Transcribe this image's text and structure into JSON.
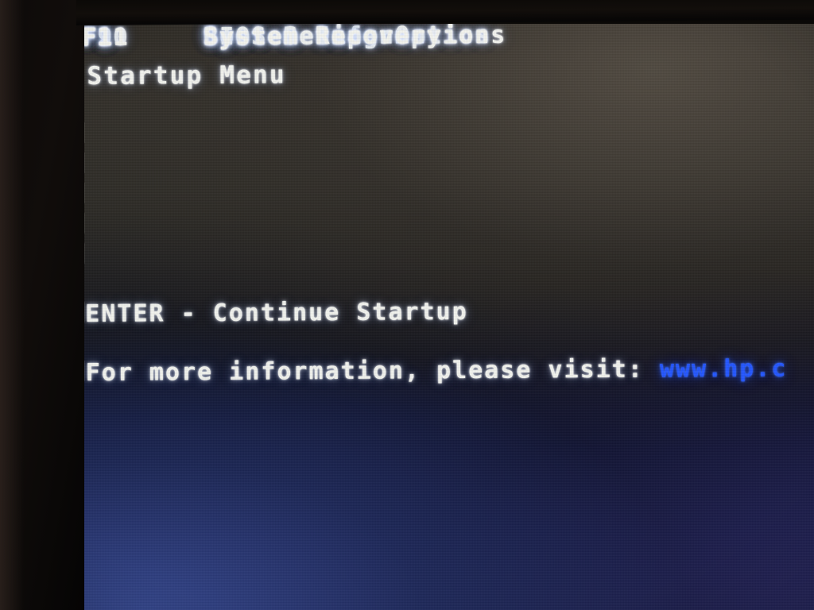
{
  "screen": {
    "kind": "bios-startup-menu",
    "title": "Startup Menu",
    "menu": [
      {
        "key": "F1",
        "label": "System Information"
      },
      {
        "key": "F2",
        "label": "System Diagnostics"
      },
      {
        "key": "F9",
        "label": "Boot Device Options"
      },
      {
        "key": "F10",
        "label": "BIOS Setup"
      },
      {
        "key": "F11",
        "label": "System Recovery"
      }
    ],
    "continue_line": "ENTER - Continue Startup",
    "info_prefix": "For more information, please visit: ",
    "info_url": "www.hp.c",
    "colors": {
      "text": "#f2f3ee",
      "url": "#2457ff",
      "background_top": "#2d2a24",
      "background_bottom": "#222d5e",
      "bezel": "#0d0a09"
    }
  }
}
